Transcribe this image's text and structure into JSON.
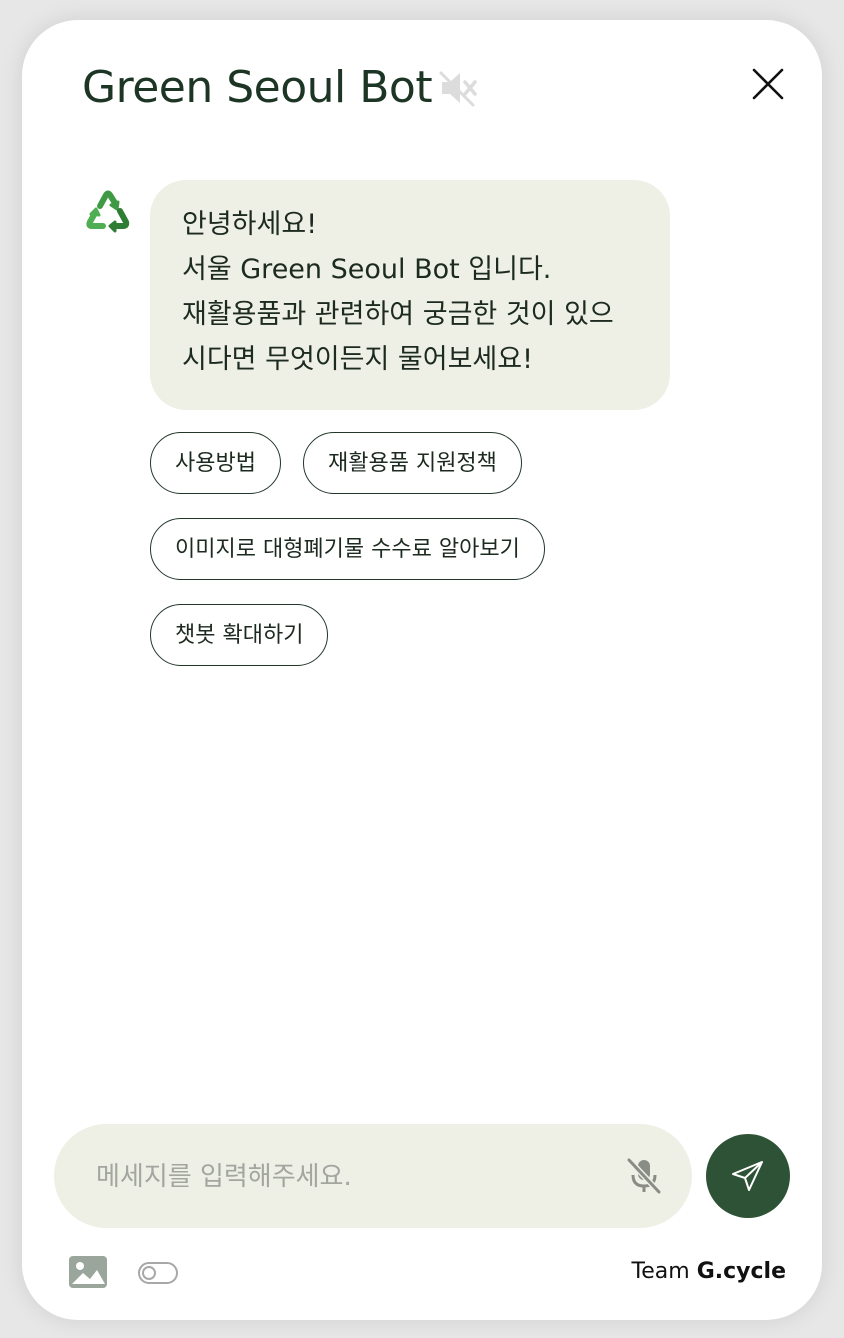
{
  "header": {
    "title": "Green Seoul Bot",
    "mute_icon": "speaker-muted-icon",
    "close_icon": "close-icon"
  },
  "message": {
    "avatar_icon": "recycle-icon",
    "lines": [
      "안녕하세요!",
      "서울 Green Seoul Bot 입니다.",
      "재활용품과 관련하여 궁금한 것이 있으",
      "시다면 무엇이든지 물어보세요!"
    ]
  },
  "quick_replies": [
    "사용방법",
    "재활용품 지원정책",
    "이미지로 대형폐기물 수수료 알아보기",
    "챗봇 확대하기"
  ],
  "input": {
    "placeholder": "메세지를 입력해주세요.",
    "value": "",
    "mic_icon": "mic-off-icon"
  },
  "send_icon": "send-icon",
  "footer": {
    "image_icon": "image-icon",
    "toggle_state": "off",
    "credit_prefix": "Team",
    "credit_name": "G.cycle"
  },
  "colors": {
    "brand_dark_green": "#2e5235",
    "bubble_bg": "#eef0e6",
    "title_color": "#1d3524"
  }
}
